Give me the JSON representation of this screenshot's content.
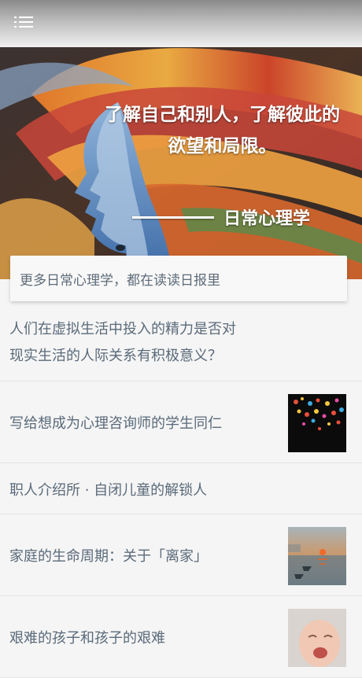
{
  "header": {
    "menu_icon": "list-menu-icon"
  },
  "hero": {
    "quote_line1": "了解自己和别人，了解彼此的",
    "quote_line2": "欲望和局限。",
    "signature": "日常心理学"
  },
  "promo": {
    "label": "更多日常心理学，都在读读日报里"
  },
  "articles": [
    {
      "title_line1": "人们在虚拟生活中投入的精力是否对",
      "title_line2": "现实生活的人际关系有积极意义？"
    },
    {
      "title": "写给想成为心理咨询师的学生同仁",
      "thumb": "fireworks-image"
    },
    {
      "title": "职人介绍所 · 自闭儿童的解锁人"
    },
    {
      "title": "家庭的生命周期：关于「离家」",
      "thumb": "sunrise-painting-image"
    },
    {
      "title": "艰难的孩子和孩子的艰难",
      "thumb": "crying-baby-image"
    }
  ],
  "colors": {
    "text": "#5a6a7a",
    "background": "#f5f5f5"
  }
}
